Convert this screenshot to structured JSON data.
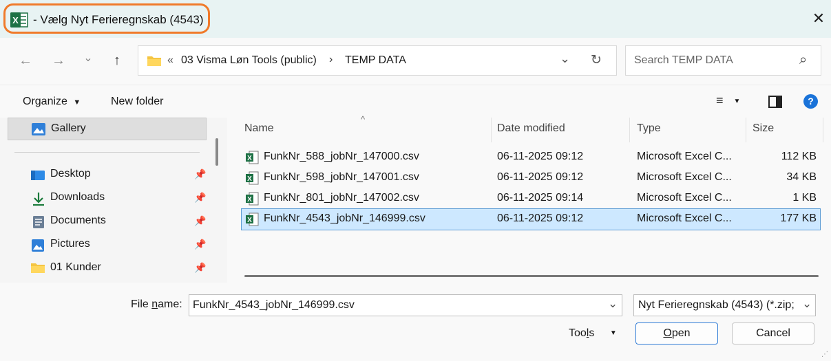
{
  "window": {
    "title": "- Vælg Nyt Ferieregnskab (4543)",
    "close_glyph": "✕"
  },
  "nav": {
    "back_glyph": "←",
    "forward_glyph": "→",
    "recent_glyph": "⌄",
    "up_glyph": "↑",
    "address_prefix": "«",
    "breadcrumb": [
      "03 Visma Løn Tools (public)",
      "TEMP DATA"
    ],
    "breadcrumb_sep": "›",
    "dropdown_glyph": "⌄",
    "refresh_glyph": "↻",
    "search_placeholder": "Search TEMP DATA",
    "search_glyph": "⌕"
  },
  "toolbar": {
    "organize_label": "Organize",
    "new_folder_label": "New folder",
    "help_glyph": "?"
  },
  "sidebar": {
    "gallery": "Gallery",
    "items": [
      {
        "label": "Desktop",
        "icon": "desktop-icon"
      },
      {
        "label": "Downloads",
        "icon": "downloads-icon"
      },
      {
        "label": "Documents",
        "icon": "documents-icon"
      },
      {
        "label": "Pictures",
        "icon": "pictures-icon"
      },
      {
        "label": "01 Kunder",
        "icon": "folder-icon"
      }
    ],
    "pin_glyph": "📌"
  },
  "columns": {
    "name": "Name",
    "date": "Date modified",
    "type": "Type",
    "size": "Size",
    "sort_glyph": "^"
  },
  "files": [
    {
      "name": "FunkNr_588_jobNr_147000.csv",
      "date": "06-11-2025 09:12",
      "type": "Microsoft Excel C...",
      "size": "112 KB"
    },
    {
      "name": "FunkNr_598_jobNr_147001.csv",
      "date": "06-11-2025 09:12",
      "type": "Microsoft Excel C...",
      "size": "34 KB"
    },
    {
      "name": "FunkNr_801_jobNr_147002.csv",
      "date": "06-11-2025 09:14",
      "type": "Microsoft Excel C...",
      "size": "1 KB"
    },
    {
      "name": "FunkNr_4543_jobNr_146999.csv",
      "date": "06-11-2025 09:12",
      "type": "Microsoft Excel C...",
      "size": "177 KB"
    }
  ],
  "footer": {
    "file_name_label_pre": "File ",
    "file_name_label_u": "n",
    "file_name_label_post": "ame:",
    "file_name_value": "FunkNr_4543_jobNr_146999.csv",
    "file_type_value": "Nyt Ferieregnskab (4543) (*.zip;",
    "tools_pre": "Too",
    "tools_u": "l",
    "tools_post": "s",
    "open_u": "O",
    "open_post": "pen",
    "cancel_label": "Cancel"
  },
  "colors": {
    "accent": "#f07a2a",
    "selection": "#cde8ff",
    "excel_green": "#1e7145"
  }
}
